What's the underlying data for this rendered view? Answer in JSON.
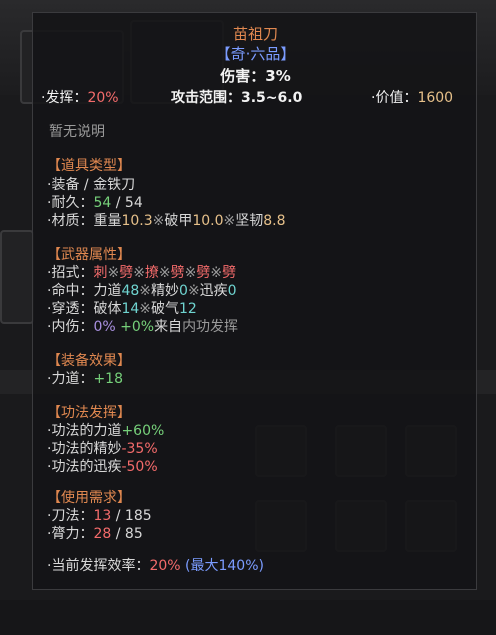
{
  "tooltip": {
    "name": "苗祖刀",
    "rarity": "【奇·六品】",
    "damage_label": "伤害：",
    "damage_value": "3%",
    "effect_label": "·发挥：",
    "effect_value": "20%",
    "range_label": "攻击范围：",
    "range_value": "3.5~6.0",
    "price_label": "·价值：",
    "price_value": "1600",
    "no_desc": "暂无说明",
    "item_type": {
      "title": "【道具类型】",
      "equip_label": "·装备 / ",
      "equip_value": "金铁刀",
      "durability_label": "·耐久：",
      "durability_cur": "54",
      "durability_sep": " / ",
      "durability_max": "54",
      "material_label": "·材质：",
      "weight_label": "重量",
      "weight_value": "10.3",
      "sep1": "※",
      "armor_break_label": "破甲",
      "armor_break_value": "10.0",
      "sep2": "※",
      "toughness_label": "坚韧",
      "toughness_value": "8.8"
    },
    "weapon_attr": {
      "title": "【武器属性】",
      "moves_label": "·招式：",
      "moves": [
        "刺",
        "※",
        "劈",
        "※",
        "撩",
        "※",
        "劈",
        "※",
        "劈",
        "※",
        "劈"
      ],
      "hit_label": "·命中：",
      "hit_str_label": "力道",
      "hit_str_value": "48",
      "hit_sep1": "※",
      "hit_skill_label": "精妙",
      "hit_skill_value": "0",
      "hit_sep2": "※",
      "hit_speed_label": "迅疾",
      "hit_speed_value": "0",
      "pierce_label": "·穿透：",
      "pierce_body_label": "破体",
      "pierce_body_value": "14",
      "pierce_sep": "※",
      "pierce_qi_label": "破气",
      "pierce_qi_value": "12",
      "inner_label": "·内伤：",
      "inner_value": "0%",
      "inner_bonus": " +0%",
      "inner_from": "来自",
      "inner_source": "内功发挥"
    },
    "equip_effect": {
      "title": "【装备效果】",
      "str_label": "·力道：",
      "str_value": "+18"
    },
    "skill_effect": {
      "title": "【功法发挥】",
      "line1_label": "·功法的力道",
      "line1_value": "+60%",
      "line2_label": "·功法的精妙",
      "line2_value": "-35%",
      "line3_label": "·功法的迅疾",
      "line3_value": "-50%"
    },
    "requirements": {
      "title": "【使用需求】",
      "blade_label": "·刀法：",
      "blade_cur": "13",
      "blade_sep": " / ",
      "blade_req": "185",
      "arm_label": "·膂力：",
      "arm_cur": "28",
      "arm_sep": " / ",
      "arm_req": "85"
    },
    "efficiency_label": "·当前发挥效率：",
    "efficiency_value": "20%",
    "efficiency_max": "(最大140%)"
  },
  "colors": {
    "section_title": "#e08850",
    "rarity": "#7b9cff",
    "price": "#e6c08a",
    "negative": "#f36b6b",
    "positive": "#76d07a",
    "cyan": "#6fd4d0",
    "lilac": "#a990e0"
  }
}
